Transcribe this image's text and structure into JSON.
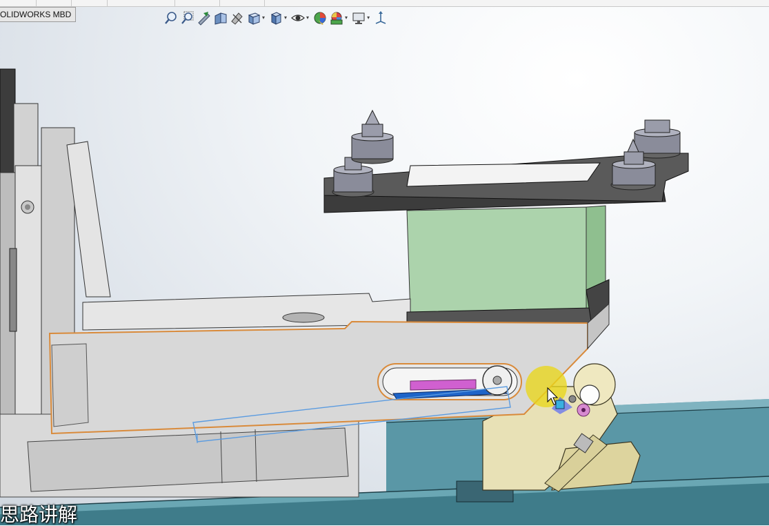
{
  "app": {
    "command_tab_label": "OLIDWORKS MBD"
  },
  "heads_up_toolbar": {
    "buttons": [
      {
        "icon": "zoom-to-fit-icon",
        "has_dropdown": false
      },
      {
        "icon": "zoom-to-area-icon",
        "has_dropdown": false
      },
      {
        "icon": "previous-view-icon",
        "has_dropdown": false
      },
      {
        "icon": "section-view-icon",
        "has_dropdown": false
      },
      {
        "icon": "dynamic-annotation-icon",
        "has_dropdown": false
      },
      {
        "icon": "view-orientation-icon",
        "has_dropdown": true
      },
      {
        "icon": "display-style-icon",
        "has_dropdown": true
      },
      {
        "icon": "hide-show-items-icon",
        "has_dropdown": true
      },
      {
        "icon": "edit-appearance-icon",
        "has_dropdown": false
      },
      {
        "icon": "apply-scene-icon",
        "has_dropdown": true
      },
      {
        "icon": "view-settings-icon",
        "has_dropdown": true
      },
      {
        "icon": "triad-icon",
        "has_dropdown": false
      }
    ]
  },
  "colors": {
    "background_top": "#ffffff",
    "background_bottom": "#cfd6de",
    "plate_dark": "#4d4d4d",
    "body_light": "#d7d7d7",
    "green_block": "#acd3ac",
    "teal_rail": "#4f8f9f",
    "tan_bracket": "#e6dfb4",
    "selection_orange": "#d98a3a",
    "preview_blue": "#5a9be0",
    "magenta_part": "#d060d0",
    "cursor_highlight": "#e9d61a"
  },
  "caption": {
    "text": "思路讲解"
  }
}
